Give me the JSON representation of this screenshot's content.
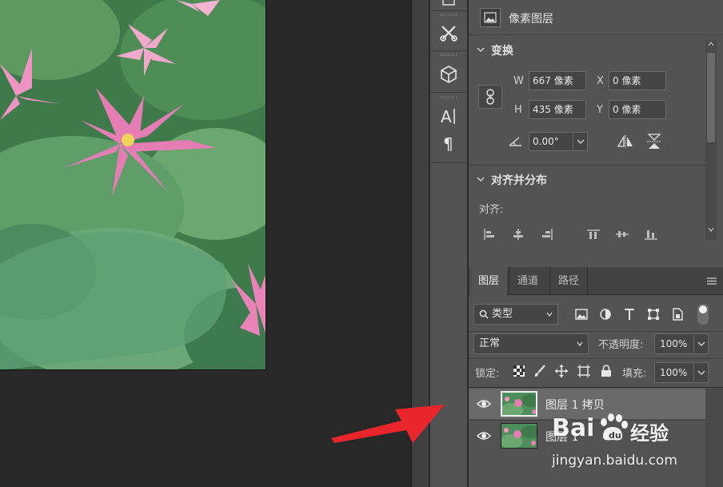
{
  "properties": {
    "header_label": "像素图层",
    "transform_title": "变换",
    "w_label": "W",
    "w_value": "667 像素",
    "h_label": "H",
    "h_value": "435 像素",
    "x_label": "X",
    "x_value": "0 像素",
    "y_label": "Y",
    "y_value": "0 像素",
    "angle_value": "0.00°",
    "align_title": "对齐并分布",
    "align_label": "对齐:"
  },
  "layers_panel": {
    "tabs": [
      {
        "label": "图层",
        "active": true
      },
      {
        "label": "通道",
        "active": false
      },
      {
        "label": "路径",
        "active": false
      }
    ],
    "filter_kind": "类型",
    "blend_mode": "正常",
    "opacity_label": "不透明度:",
    "opacity_value": "100%",
    "lock_label": "锁定:",
    "fill_label": "填充:",
    "fill_value": "100%",
    "layers": [
      {
        "name": "图层 1 拷贝",
        "selected": true,
        "visible": true
      },
      {
        "name": "图层 1",
        "selected": false,
        "visible": true
      }
    ]
  },
  "watermark": {
    "brand": "Bai",
    "brand_suffix": "经验",
    "url": "jingyan.baidu.com"
  },
  "colors": {
    "panel_bg": "#535353",
    "canvas_bg": "#282828",
    "arrow": "#e8262b",
    "selected_layer": "#6a6a6a"
  }
}
